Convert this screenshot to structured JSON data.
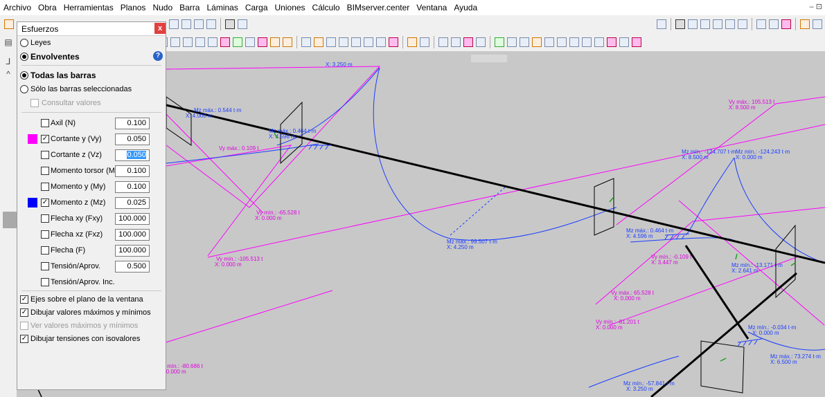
{
  "menu": [
    "Archivo",
    "Obra",
    "Herramientas",
    "Planos",
    "Nudo",
    "Barra",
    "Láminas",
    "Carga",
    "Uniones",
    "Cálculo",
    "BIMserver.center",
    "Ventana",
    "Ayuda"
  ],
  "window_controls": "– ⊡",
  "panel": {
    "title": "Esfuerzos",
    "close": "x",
    "help": "?",
    "mode_leyes": "Leyes",
    "mode_envolventes": "Envolventes",
    "todas_barras": "Todas las barras",
    "solo_seleccionadas": "Sólo las barras seleccionadas",
    "consultar_valores": "Consultar valores",
    "rows": [
      {
        "label": "Axil (N)",
        "checked": false,
        "value": "0.100",
        "swatch": ""
      },
      {
        "label": "Cortante y (Vy)",
        "checked": true,
        "value": "0.050",
        "swatch": "#ff00ff"
      },
      {
        "label": "Cortante z (Vz)",
        "checked": false,
        "value": "0.050",
        "swatch": ""
      },
      {
        "label": "Momento torsor (Mt)",
        "checked": false,
        "value": "0.100",
        "swatch": ""
      },
      {
        "label": "Momento y (My)",
        "checked": false,
        "value": "0.100",
        "swatch": ""
      },
      {
        "label": "Momento z (Mz)",
        "checked": true,
        "value": "0.025",
        "swatch": "#0000ff"
      },
      {
        "label": "Flecha xy (Fxy)",
        "checked": false,
        "value": "100.000",
        "swatch": ""
      },
      {
        "label": "Flecha xz (Fxz)",
        "checked": false,
        "value": "100.000",
        "swatch": ""
      },
      {
        "label": "Flecha (F)",
        "checked": false,
        "value": "100.000",
        "swatch": ""
      },
      {
        "label": "Tensión/Aprov.",
        "checked": false,
        "value": "0.500",
        "swatch": ""
      },
      {
        "label": "Tensión/Aprov. Inc.",
        "checked": false,
        "value": "",
        "swatch": ""
      }
    ],
    "options": [
      {
        "label": "Ejes sobre el plano de la ventana",
        "checked": true,
        "disabled": false
      },
      {
        "label": "Dibujar valores máximos y mínimos",
        "checked": true,
        "disabled": false
      },
      {
        "label": "Ver valores máximos y mínimos",
        "checked": false,
        "disabled": true
      },
      {
        "label": "Dibujar tensiones con isovalores",
        "checked": true,
        "disabled": false
      }
    ]
  },
  "annotations": {
    "a1": "X: 3.250 m",
    "a2": "Vy máx.: 105.513 t",
    "a3": "X: 8.500 m",
    "a4": "Mz mín.: -124.707 t·m",
    "a5": "Mz mín.: -124.243 t·m",
    "a6": "X: 8.500 m",
    "a7": "X: 0.000 m",
    "a8": "Mz máx.: 0.464 t·m",
    "a9": "X: 4.596 m",
    "a10": "Vy máx.: 0.109 t",
    "a11": "Vy mín.: -65.528 t",
    "a12": "X: 0.000 m",
    "a13": "Mz máx.: 99.507 t·m",
    "a14": "X: 4.250 m",
    "a15": "Vy mín.: -105.513 t",
    "a16": "X: 0.000 m",
    "a17": "Mz máx.: 0.464 t·m",
    "a18": "X: 4.596 m",
    "a19": "Vy mín.: -0.109 t",
    "a20": "X: 3.447 m",
    "a21": "Mz mín.: -13.171 t·m",
    "a22": "X: 2.641 m",
    "a23": "Vy máx.: 65.528 t",
    "a24": "X: 0.000 m",
    "a25": "Vy mín.: -81.201 t",
    "a26": "X: 0.000 m",
    "a27": "Mz mín.: -0.034 t·m",
    "a28": "X: 0.000 m",
    "a29": "Mz máx.: 73.274 t·m",
    "a30": "X: 6.500 m",
    "a31": "Mz mín.: -57.841 t·m",
    "a32": "X: 3.250 m",
    "a33": "Vy mín.: -80.686 t",
    "a34": "X: 0.000 m",
    "a35": "Mz máx.: 0.544 t·m",
    "a36": "X: 4.000 m"
  },
  "colors": {
    "shear": "#ff00ff",
    "moment": "#0000ff",
    "beam": "#000000",
    "canvas": "#c8c8c8"
  }
}
